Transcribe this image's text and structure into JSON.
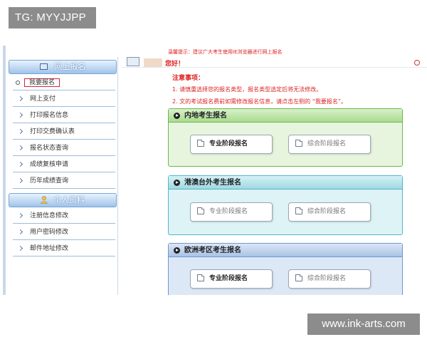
{
  "badges": {
    "tag": "TG: MYYJJPP",
    "watermark": "www.ink-arts.com"
  },
  "sidebar": {
    "online_header": "网上报名",
    "online_items": [
      "我要报名",
      "网上支付",
      "打印报名信息",
      "打印交费确认表",
      "报名状态查询",
      "成绩复核申请",
      "历年成绩查询"
    ],
    "personal_header": "个人资料",
    "personal_items": [
      "注册信息修改",
      "用户密码修改",
      "邮件地址修改"
    ]
  },
  "header": {
    "notice": "温馨提示：建议广大考生使用IE浏览器进行网上报名",
    "greeting": "您好！"
  },
  "notes": {
    "title": "注意事项：",
    "items": [
      "1. 请慎重选择您的报名类型，报名类型选定后将无法修改。",
      "2. 文的考试报名费前如需修改报名信息，请点击左侧的 “我要报名”。"
    ]
  },
  "panels": [
    {
      "title": "内地考生报名",
      "buttons": [
        "专业阶段报名",
        "综合阶段报名"
      ]
    },
    {
      "title": "港澳台外考生报名",
      "buttons": [
        "专业阶段报名",
        "综合阶段报名"
      ]
    },
    {
      "title": "欧洲考区考生报名",
      "buttons": [
        "专业阶段报名",
        "综合阶段报名"
      ]
    }
  ]
}
